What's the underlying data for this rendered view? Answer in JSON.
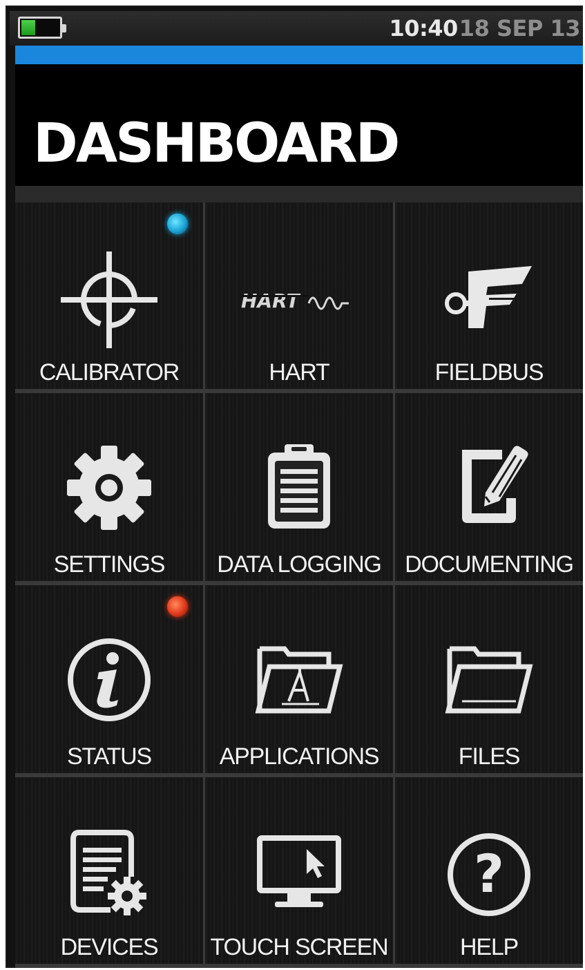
{
  "status_bar": {
    "battery_level": 0.35,
    "battery_color": "#2db82d",
    "time": "10:40",
    "date": "18 SEP 13"
  },
  "accent_color": "#1a86dc",
  "header": {
    "title": "DASHBOARD"
  },
  "tiles": [
    {
      "label": "CALIBRATOR",
      "icon": "crosshair-icon",
      "indicator": "blue"
    },
    {
      "label": "HART",
      "icon": "hart-logo-icon"
    },
    {
      "label": "FIELDBUS",
      "icon": "fieldbus-icon"
    },
    {
      "label": "SETTINGS",
      "icon": "gear-icon"
    },
    {
      "label": "DATA LOGGING",
      "icon": "clipboard-icon"
    },
    {
      "label": "DOCUMENTING",
      "icon": "document-pen-icon"
    },
    {
      "label": "STATUS",
      "icon": "info-icon",
      "indicator": "red"
    },
    {
      "label": "APPLICATIONS",
      "icon": "applications-folder-icon"
    },
    {
      "label": "FILES",
      "icon": "folder-icon"
    },
    {
      "label": "DEVICES",
      "icon": "device-settings-icon"
    },
    {
      "label": "TOUCH SCREEN",
      "icon": "monitor-cursor-icon"
    },
    {
      "label": "HELP",
      "icon": "question-icon"
    }
  ]
}
